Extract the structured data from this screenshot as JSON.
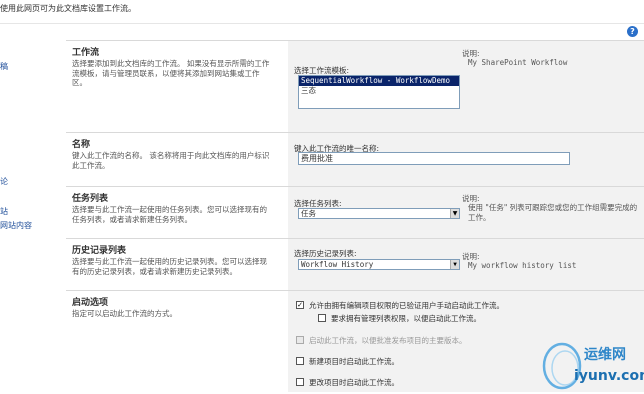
{
  "header": {
    "description": "使用此网页可为此文档库设置工作流。"
  },
  "help_icon_glyph": "?",
  "leftnav": {
    "fragments": [
      "稿",
      "",
      "论",
      "站",
      "网站内容"
    ]
  },
  "workflow": {
    "title": "工作流",
    "description": "选择要添加到此文档库的工作流。 如果没有显示所需的工作流模板，请与管理员联系，以便将其添加到网站集或工作区。",
    "template_label": "选择工作流模板:",
    "templates": [
      "SequentialWorkflow - WorkflowDemo",
      "三态"
    ],
    "note_label": "说明:",
    "note_text": "My SharePoint Workflow"
  },
  "name": {
    "title": "名称",
    "description": "键入此工作流的名称。 该名称将用于向此文档库的用户标识此工作流。",
    "input_label": "键入此工作流的唯一名称:",
    "input_value": "费用批准"
  },
  "task_list": {
    "title": "任务列表",
    "description": "选择要与此工作流一起使用的任务列表。您可以选择现有的任务列表，或者请求新建任务列表。",
    "select_label": "选择任务列表:",
    "selected": "任务",
    "note_label": "说明:",
    "note_text": "使用 \"任务\" 列表可跟踪您或您的工作组需要完成的工作。"
  },
  "history_list": {
    "title": "历史记录列表",
    "description": "选择要与此工作流一起使用的历史记录列表。您可以选择现有的历史记录列表，或者请求新建历史记录列表。",
    "select_label": "选择历史记录列表:",
    "selected": "Workflow History",
    "note_label": "说明:",
    "note_text": "My workflow history list"
  },
  "start_options": {
    "title": "启动选项",
    "description": "指定可以启动此工作流的方式。",
    "options": [
      {
        "label": "允许由拥有编辑项目权限的已验证用户手动启动此工作流。",
        "checked": true,
        "disabled": false
      },
      {
        "label": "要求拥有管理列表权限，以便启动此工作流。",
        "checked": false,
        "disabled": false
      },
      {
        "label": "启动此工作流，以便批准发布项目的主要版本。",
        "checked": false,
        "disabled": true
      },
      {
        "label": "新建项目时启动此工作流。",
        "checked": false,
        "disabled": false
      },
      {
        "label": "更改项目时启动此工作流。",
        "checked": false,
        "disabled": false
      }
    ],
    "check_glyph": "✓"
  },
  "watermark": {
    "brand": "运维网",
    "url": "iyunv.com"
  }
}
